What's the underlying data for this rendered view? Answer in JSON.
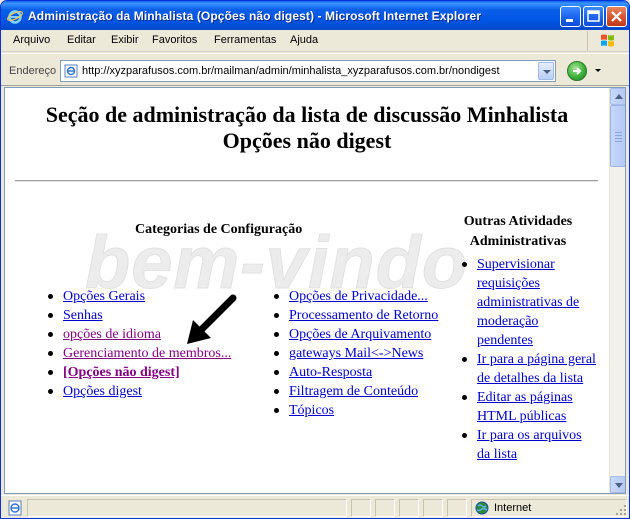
{
  "window": {
    "title": "Administração da Minhalista (Opções não digest) - Microsoft Internet Explorer"
  },
  "menu": [
    "Arquivo",
    "Editar",
    "Exibir",
    "Favoritos",
    "Ferramentas",
    "Ajuda"
  ],
  "address": {
    "label": "Endereço",
    "url": "http://xyzparafusos.com.br/mailman/admin/minhalista_xyzparafusos.com.br/nondigest"
  },
  "page": {
    "heading_line1": "Seção de administração da lista de discussão Minhalista",
    "heading_line2": "Opções não digest",
    "watermark": "bem-vindo",
    "categories_title": "Categorias de Configuração",
    "other_title_line1": "Outras Atividades",
    "other_title_line2": "Administrativas",
    "col1": [
      {
        "text": "Opções Gerais",
        "state": "link"
      },
      {
        "text": "Senhas",
        "state": "link"
      },
      {
        "text": "opções de idioma",
        "state": "visited"
      },
      {
        "text": "Gerenciamento de membros...",
        "state": "visited"
      },
      {
        "text": "[Opções não digest]",
        "state": "current"
      },
      {
        "text": "Opções digest",
        "state": "link"
      }
    ],
    "col2": [
      {
        "text": "Opções de Privacidade...",
        "state": "link"
      },
      {
        "text": "Processamento de Retorno",
        "state": "link"
      },
      {
        "text": "Opções de Arquivamento",
        "state": "link"
      },
      {
        "text": "gateways Mail<->News",
        "state": "link"
      },
      {
        "text": "Auto-Resposta",
        "state": "link"
      },
      {
        "text": "Filtragem de Conteúdo",
        "state": "link"
      },
      {
        "text": "Tópicos",
        "state": "link"
      }
    ],
    "col3": [
      {
        "text": "Supervisionar requisições administrativas de moderação pendentes",
        "state": "link"
      },
      {
        "text": "Ir para a página geral de detalhes da lista",
        "state": "link"
      },
      {
        "text": "Editar as páginas HTML públicas",
        "state": "link"
      },
      {
        "text": "Ir para os arquivos da lista",
        "state": "link"
      }
    ]
  },
  "status": {
    "zone": "Internet"
  },
  "colors": {
    "link": "#0000CC",
    "visited": "#800080",
    "titlebar": "#0054E3"
  }
}
